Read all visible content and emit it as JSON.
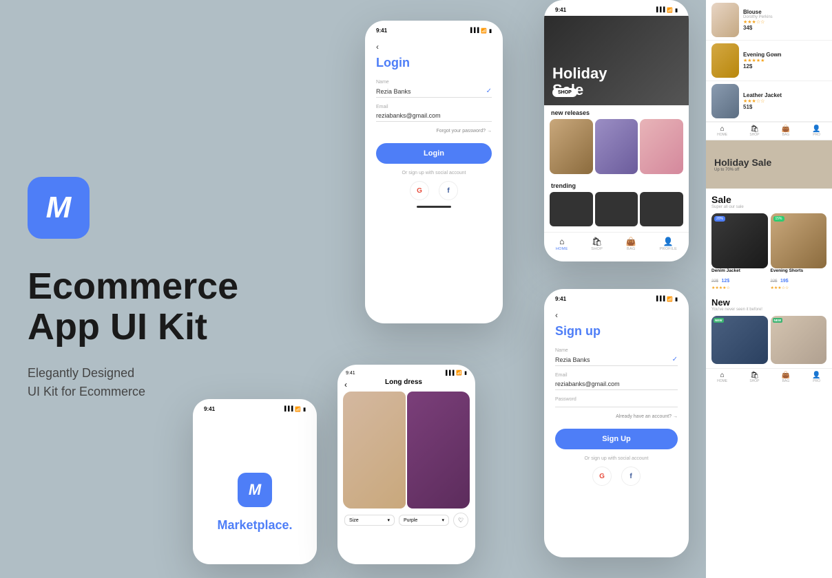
{
  "app": {
    "background": "#b0bec5"
  },
  "left": {
    "logo_letter": "M",
    "title_line1": "Ecommerce",
    "title_line2": "App UI Kit",
    "subtitle_line1": "Elegantly Designed",
    "subtitle_line2": "UI Kit for Ecommerce"
  },
  "login_screen": {
    "time": "9:41",
    "title": "Login",
    "name_label": "Name",
    "name_value": "Rezia Banks",
    "email_label": "Email",
    "email_value": "reziabanks@gmail.com",
    "forgot_password": "Forgot your password? →",
    "btn_label": "Login",
    "social_text": "Or sign up with social account",
    "google_letter": "G",
    "facebook_letter": "f"
  },
  "signup_screen": {
    "time": "9:41",
    "title": "Sign up",
    "name_label": "Name",
    "name_value": "Rezia Banks",
    "email_label": "Email",
    "email_value": "reziabanks@gmail.com",
    "password_label": "Password",
    "already_account": "Already have an account? →",
    "btn_label": "Sign Up",
    "social_text": "Or sign up with social account",
    "google_letter": "G",
    "facebook_letter": "f"
  },
  "marketplace_screen": {
    "time": "9:41",
    "logo_letter": "M",
    "name": "Marketplace."
  },
  "dress_screen": {
    "time": "9:41",
    "title": "Long dress",
    "size_label": "Size",
    "color_label": "Purple"
  },
  "home_screen": {
    "time": "9:41",
    "sale_title": "Holiday",
    "sale_title2": "Sale",
    "shop_btn": "SHOP",
    "new_releases_label": "new releases",
    "trending_label": "trending",
    "nav_items": [
      "HOME",
      "SHOP",
      "BAG",
      "PROFILE"
    ]
  },
  "products": [
    {
      "name": "Blouse",
      "brand": "Dorothy Perkins",
      "price": "34$",
      "stars": 3,
      "thumb_class": "thumb-blouse"
    },
    {
      "name": "Evening Gown",
      "brand": "",
      "price": "12$",
      "stars": 5,
      "thumb_class": "thumb-gown"
    },
    {
      "name": "Leather Jacket",
      "brand": "",
      "price": "51$",
      "stars": 3,
      "thumb_class": "thumb-jacket"
    }
  ],
  "sale_section": {
    "title": "Sale",
    "subtitle": "Super all our sale",
    "items": [
      {
        "badge": "20%",
        "name": "Denim Jacket",
        "old_price": "22$",
        "new_price": "12$",
        "card_class": "sc-dark",
        "badge_class": "sale-badge"
      },
      {
        "badge": "15%",
        "name": "Evening Shorts",
        "old_price": "22$",
        "new_price": "19$",
        "card_class": "sc-tan",
        "badge_class": "sale-badge-green"
      }
    ]
  },
  "holiday_banner": {
    "title": "Holiday Sale",
    "subtitle": "Up to 70% off"
  },
  "new_section": {
    "title": "New",
    "subtitle": "You've never seen it before!",
    "items": [
      {
        "badge": "NEW",
        "card_class": "nc-blue"
      },
      {
        "badge": "NEW",
        "card_class": "nc-beige"
      }
    ]
  },
  "right_nav": {
    "items": [
      "HOME",
      "SHOP",
      "BAG",
      "PRO"
    ]
  }
}
